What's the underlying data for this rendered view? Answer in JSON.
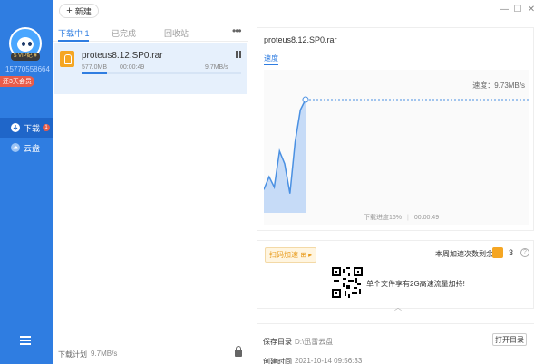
{
  "user": {
    "vip_badge": "$ VIP纪 ¥",
    "phone": "15770558664",
    "vip_days": "还3天会员"
  },
  "nav": {
    "items": [
      {
        "label": "下载",
        "badge": "1"
      },
      {
        "label": "云盘"
      }
    ]
  },
  "toolbar": {
    "new_label": "新建",
    "window_controls": [
      "—",
      "☐",
      "✕"
    ]
  },
  "tabs": {
    "downloading": "下载中 1",
    "completed": "已完成",
    "recycle": "回收站"
  },
  "task": {
    "name": "proteus8.12.SP0.rar",
    "size": "577.0MB",
    "time": "00:00:49",
    "speed": "9.7MB/s",
    "progress": 16
  },
  "list_footer": {
    "label": "下载计划",
    "speed": "9.7MB/s"
  },
  "detail": {
    "title": "proteus8.12.SP0.rar",
    "speed_tab": "速度",
    "current_speed": "速度：9.73MB/s",
    "progress_text": "下载进度16%",
    "elapsed": "00:00:49"
  },
  "chart_data": {
    "type": "area",
    "series": [
      {
        "values": [
          0.18,
          0.28,
          0.2,
          0.48,
          0.38,
          0.15,
          0.55,
          0.8,
          0.88,
          0.88,
          0.88,
          0.88,
          0.88,
          0.88,
          0.88,
          0.88,
          0.88,
          0.88,
          0.88,
          0.88
        ]
      }
    ],
    "ylim": [
      0,
      1
    ],
    "colors": {
      "fill": "#c6dbf7",
      "line": "#4a90e2"
    }
  },
  "accel": {
    "button": "扫码加速 ⊞ ▸",
    "remaining": "本周加速次数剩余",
    "count": "3",
    "promo": "单个文件享有2G高速流量加持!"
  },
  "info": {
    "save_label": "保存目录",
    "save_value": "D:\\迅雷云盘",
    "created_label": "创建时间",
    "created_value": "2021-10-14 09:56:33",
    "open_dir": "打开目录"
  }
}
